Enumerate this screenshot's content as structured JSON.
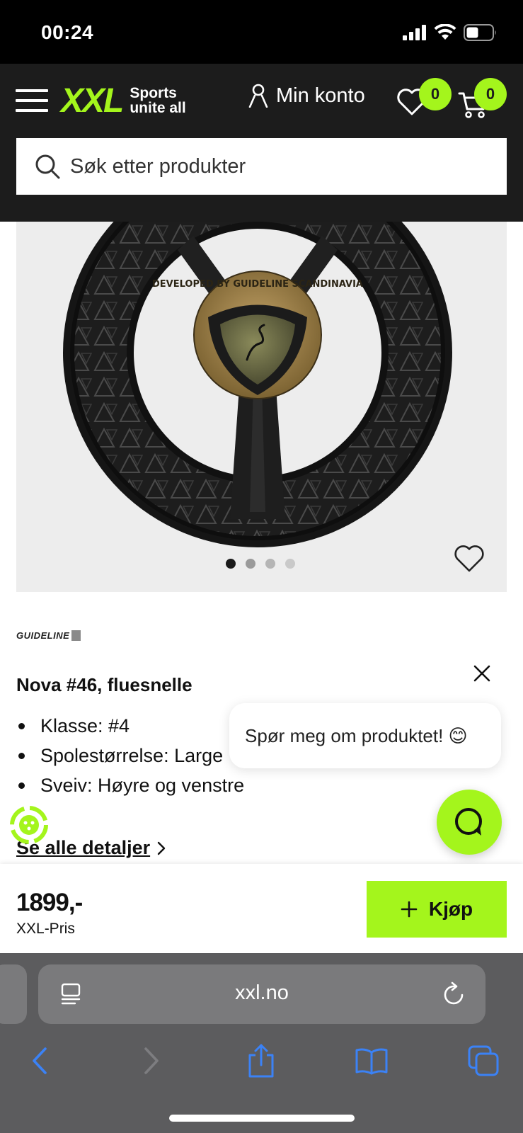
{
  "status_bar": {
    "time": "00:24"
  },
  "header": {
    "logo_text": "XXL",
    "logo_tagline_1": "Sports",
    "logo_tagline_2": "unite all",
    "account_label": "Min konto",
    "wishlist_count": "0",
    "cart_count": "0",
    "search_placeholder": "Søk etter produkter",
    "brand_color": "#a4f51c"
  },
  "gallery": {
    "image_alt": "Nova #46 fluesnelle",
    "slide_count": 4,
    "active_slide": 1,
    "reel_hub_text": "DEVELOPED BY GUIDELINE SCANDINAVIA"
  },
  "product": {
    "brand": "GUIDELINE",
    "title": "Nova #46, fluesnelle",
    "features": [
      "Klasse: #4",
      "Spolestørrelse: Large",
      "Sveiv: Høyre og venstre"
    ],
    "details_link": "Se alle detaljer"
  },
  "chat": {
    "prompt": "Spør meg om produktet! 😊"
  },
  "buy_bar": {
    "price": "1899,-",
    "price_label": "XXL-Pris",
    "buy_label": "Kjøp"
  },
  "browser": {
    "url": "xxl.no"
  }
}
